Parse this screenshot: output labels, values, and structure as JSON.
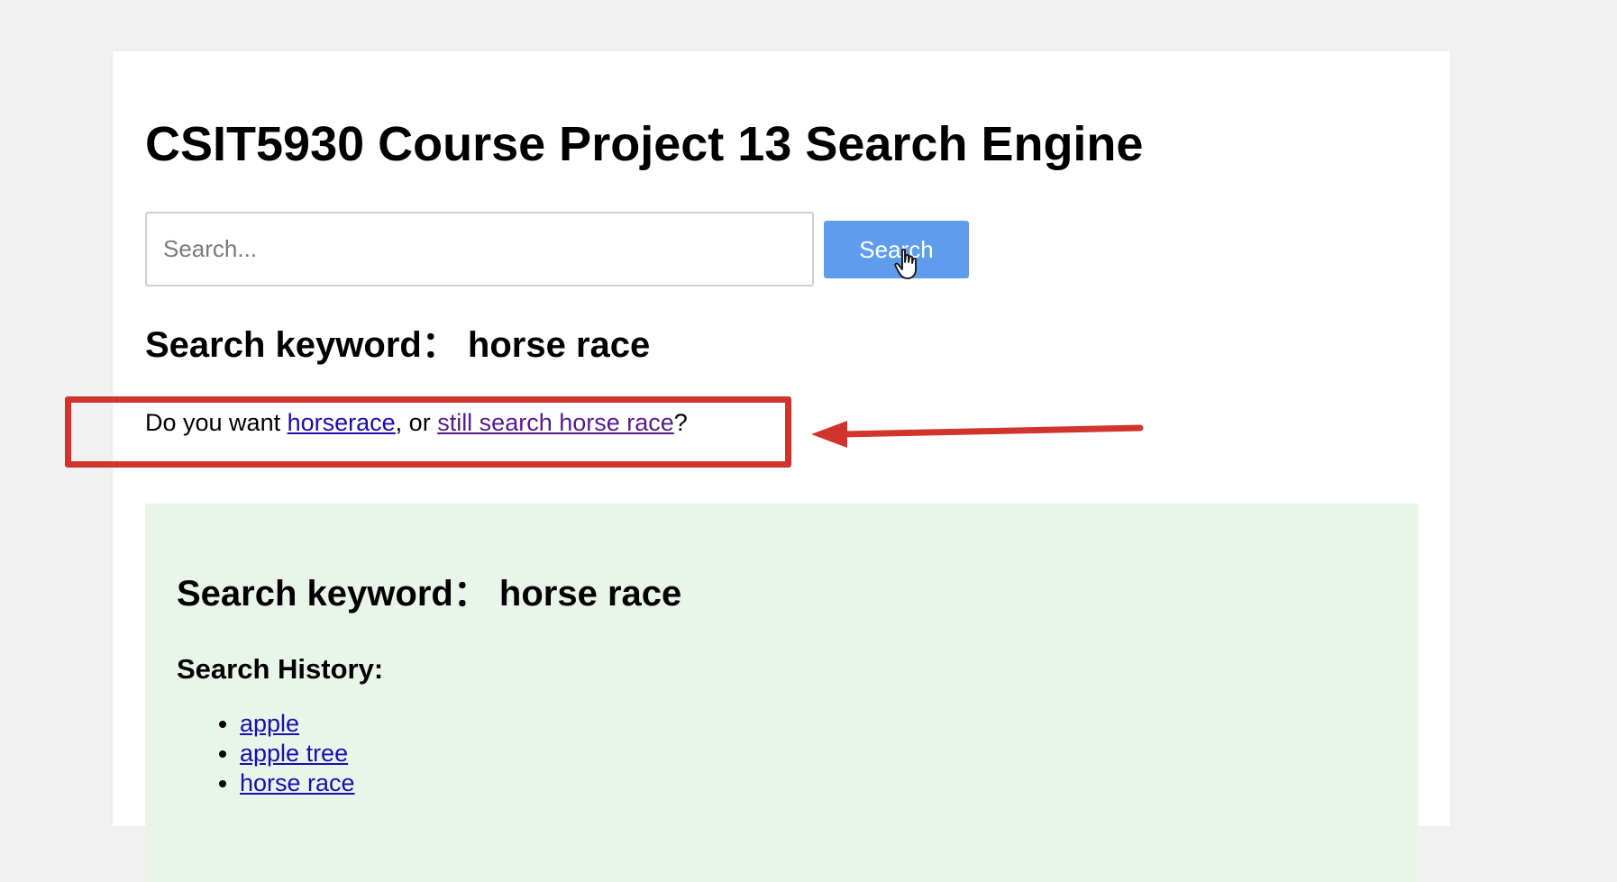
{
  "header": {
    "title": "CSIT5930 Course Project 13 Search Engine"
  },
  "search": {
    "placeholder": "Search...",
    "value": "",
    "button_label": "Search"
  },
  "keyword": {
    "heading": "Search keyword： horse race"
  },
  "suggestion": {
    "prefix": "Do you want ",
    "suggested_link": "horserace",
    "middle": ", or ",
    "original_link": "still search horse race",
    "suffix": "?"
  },
  "annotation": {
    "box_color": "#d0342c",
    "arrow_color": "#d0342c"
  },
  "history_panel": {
    "keyword_heading": "Search keyword： horse race",
    "history_title": "Search History:",
    "items": [
      {
        "label": "apple"
      },
      {
        "label": "apple tree"
      },
      {
        "label": "horse race"
      }
    ]
  },
  "colors": {
    "button": "#5f9cec",
    "link": "#1a0dab",
    "visited_link": "#551a8b",
    "panel_background": "#eaf5ea"
  }
}
